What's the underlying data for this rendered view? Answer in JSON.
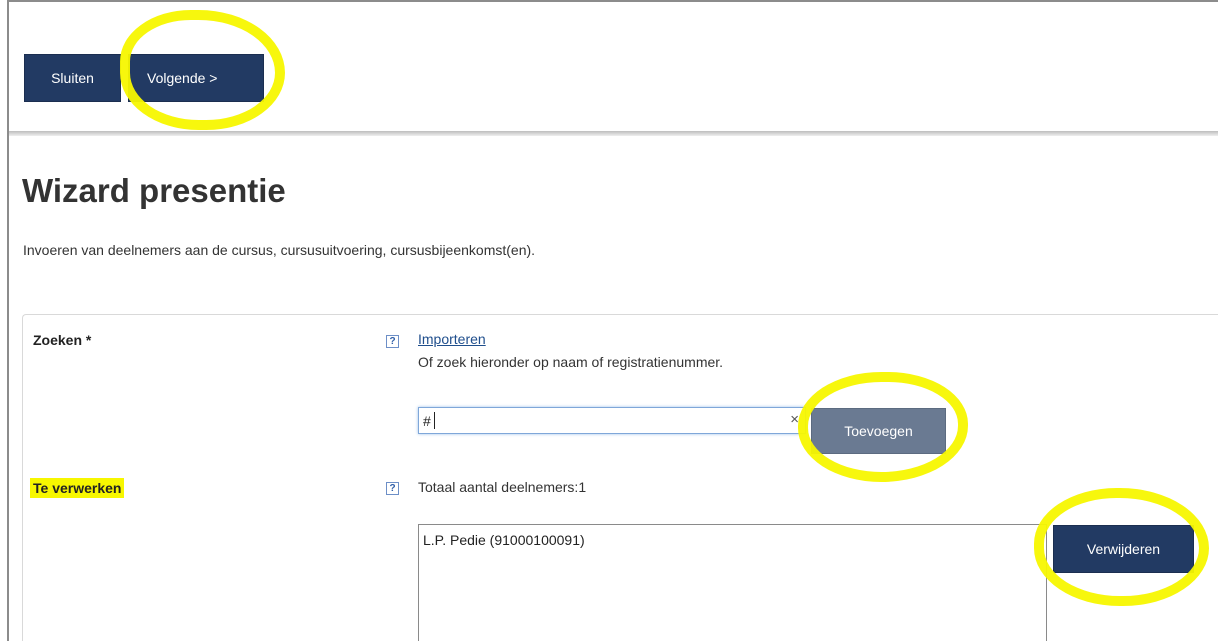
{
  "toolbar": {
    "close_label": "Sluiten",
    "next_label": "Volgende >"
  },
  "page": {
    "title": "Wizard presentie",
    "description": "Invoeren van deelnemers aan de cursus, cursusuitvoering, cursusbijeenkomst(en)."
  },
  "search": {
    "label": "Zoeken *",
    "help_icon": "?",
    "import_link": "Importeren",
    "hint": "Of zoek hieronder op naam of registratienummer.",
    "value": "#",
    "clear_icon": "×",
    "add_label": "Toevoegen"
  },
  "process": {
    "label": "Te verwerken",
    "help_icon": "?",
    "total_text": "Totaal aantal deelnemers:1",
    "participants": [
      "L.P. Pedie (91000100091)"
    ],
    "remove_label": "Verwijderen"
  },
  "colors": {
    "button_primary": "#223a63",
    "button_disabled": "#6a7a92",
    "highlight": "#f7f700",
    "link": "#1f4e8c"
  },
  "icons": {
    "help": "help-icon",
    "clear": "close-icon"
  }
}
